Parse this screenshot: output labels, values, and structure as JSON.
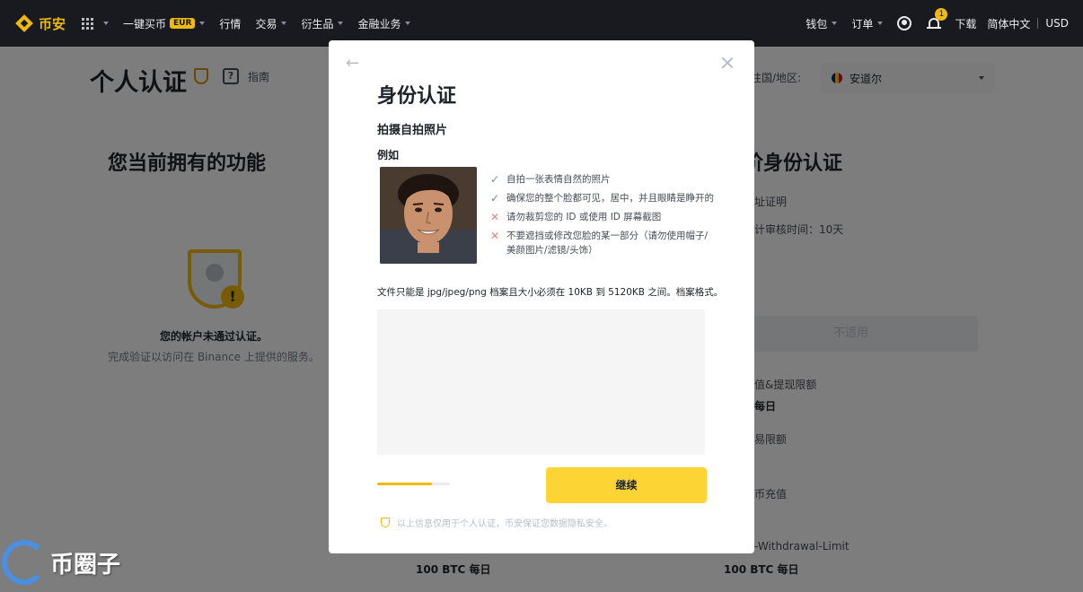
{
  "nav": {
    "brand": "币安",
    "items": [
      {
        "label": "一键买币",
        "badge": "EUR",
        "has_caret": true
      },
      {
        "label": "行情",
        "has_caret": false
      },
      {
        "label": "交易",
        "has_caret": true
      },
      {
        "label": "衍生品",
        "has_caret": true
      },
      {
        "label": "金融业务",
        "has_caret": true
      }
    ],
    "right": {
      "wallet": "钱包",
      "orders": "订单",
      "notification_count": "1",
      "download": "下载",
      "language": "简体中文",
      "currency": "USD"
    }
  },
  "page": {
    "title": "个人认证",
    "guide": "指南",
    "country_label": "往国/地区:",
    "country_value": "安道尔",
    "left_title": "您当前拥有的功能",
    "status": "您的帐户未通过认证。",
    "status_sub": "完成验证以访问在 Binance 上提供的服务。",
    "right_title": "阶身份认证",
    "right_line1": "址证明",
    "right_line2": "计审核时间：10天",
    "not_applicable": "不适用",
    "limits": [
      {
        "label": "值&提现限额",
        "value": "每日"
      },
      {
        "label": "易限额",
        "value": ""
      },
      {
        "label": "币充值",
        "value": ""
      },
      {
        "label": "-Withdrawal-Limit",
        "value": ""
      }
    ],
    "bottom_left_value": "100 BTC 每日",
    "bottom_right_value": "100 BTC 每日"
  },
  "modal": {
    "title": "身份认证",
    "subtitle": "拍摄自拍照片",
    "example_label": "例如",
    "tips": [
      {
        "type": "ok",
        "text": "自拍一张表情自然的照片"
      },
      {
        "type": "ok",
        "text": "确保您的整个脸都可见，居中，并且眼睛是睁开的"
      },
      {
        "type": "bad",
        "text": "请勿裁剪您的 ID 或使用 ID 屏幕截图"
      },
      {
        "type": "bad",
        "text": "不要遮挡或修改您脸的某一部分（请勿使用帽子/美颜图片/滤镜/头饰）"
      }
    ],
    "file_note": "文件只能是 jpg/jpeg/png 档案且大小必须在 10KB 到 5120KB 之间。档案格式。",
    "progress": 0.75,
    "continue_label": "继续",
    "privacy_note": "以上信息仅用于个人认证，币安保证您数据隐私安全。"
  },
  "watermark": {
    "text": "币圈子"
  },
  "colors": {
    "brand_yellow": "#f0b90b",
    "button_yellow": "#fcd535",
    "nav_bg": "#181a20",
    "tip_ok": "#7a8b83",
    "tip_bad": "#e0867c"
  }
}
